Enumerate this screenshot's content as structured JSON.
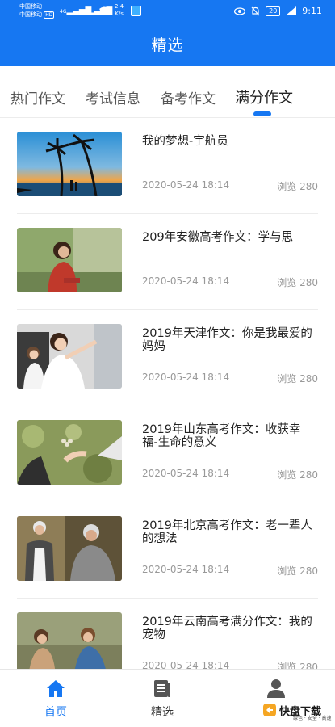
{
  "status_bar": {
    "carrier_1": "中国移动",
    "carrier_2": "中国移动",
    "network_1": "4G",
    "network_2": "4G",
    "hd_badge": "HD",
    "speed_value": "2.4",
    "speed_unit": "K/s",
    "battery": "20",
    "time": "9:11"
  },
  "app_bar": {
    "title": "精选"
  },
  "tabs": [
    {
      "label": "热门作文",
      "active": false
    },
    {
      "label": "考试信息",
      "active": false
    },
    {
      "label": "备考作文",
      "active": false
    },
    {
      "label": "满分作文",
      "active": true
    }
  ],
  "articles": [
    {
      "title": "我的梦想-宇航员",
      "date": "2020-05-24 18:14",
      "views": "浏览 280"
    },
    {
      "title": "209年安徽高考作文：学与思",
      "date": "2020-05-24 18:14",
      "views": "浏览 280"
    },
    {
      "title": "2019年天津作文：你是我最爱的妈妈",
      "date": "2020-05-24 18:14",
      "views": "浏览 280"
    },
    {
      "title": "2019年山东高考作文：收获幸福-生命的意义",
      "date": "2020-05-24 18:14",
      "views": "浏览 280"
    },
    {
      "title": "2019年北京高考作文：老一辈人的想法",
      "date": "2020-05-24 18:14",
      "views": "浏览 280"
    },
    {
      "title": "2019年云南高考满分作文：我的宠物",
      "date": "2020-05-24 18:14",
      "views": "浏览 280"
    }
  ],
  "bottom_nav": [
    {
      "label": "首页",
      "icon": "home-icon",
      "active": true
    },
    {
      "label": "精选",
      "icon": "book-icon",
      "active": false
    },
    {
      "label": "",
      "icon": "user-icon",
      "active": false
    }
  ],
  "watermark": {
    "text": "快盘下载",
    "subtext": "绿色 · 安全 · 高速"
  },
  "colors": {
    "primary": "#1677f2",
    "text": "#222222",
    "meta": "#999999"
  }
}
